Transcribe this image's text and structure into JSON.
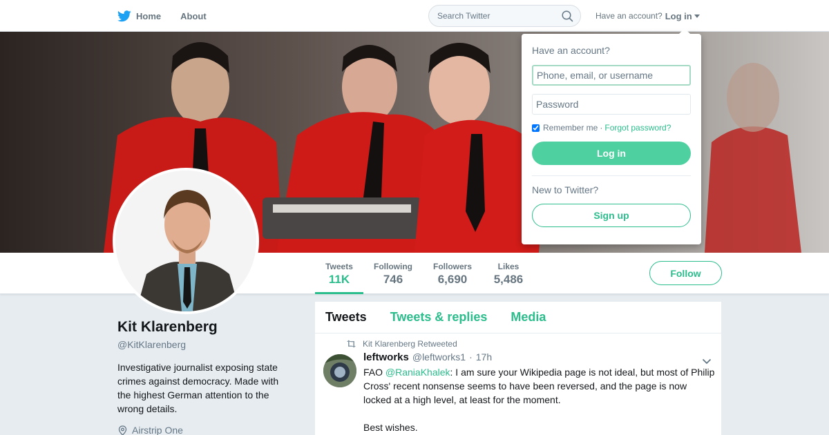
{
  "colors": {
    "accent": "#2bbd8b",
    "login_fill": "#4fd0a0",
    "muted": "#657786",
    "page_bg": "#e6ecf0"
  },
  "topbar": {
    "logo_icon": "twitter-bird-icon",
    "home_label": "Home",
    "about_label": "About",
    "search_placeholder": "Search Twitter",
    "have_account": "Have an account?",
    "login_label": "Log in"
  },
  "login_dropdown": {
    "title": "Have an account?",
    "username_placeholder": "Phone, email, or username",
    "password_placeholder": "Password",
    "remember_label": "Remember me",
    "separator": "·",
    "forgot_label": "Forgot password?",
    "login_button": "Log in",
    "new_prompt": "New to Twitter?",
    "signup_button": "Sign up"
  },
  "stats": {
    "tweets_label": "Tweets",
    "tweets_value": "11K",
    "following_label": "Following",
    "following_value": "746",
    "followers_label": "Followers",
    "followers_value": "6,690",
    "likes_label": "Likes",
    "likes_value": "5,486",
    "follow_button": "Follow"
  },
  "profile": {
    "name": "Kit Klarenberg",
    "handle": "@KitKlarenberg",
    "bio": "Investigative journalist exposing state crimes against democracy. Made with the highest German attention to the wrong details.",
    "location": "Airstrip One"
  },
  "timeline": {
    "tabs": [
      "Tweets",
      "Tweets & replies",
      "Media"
    ],
    "tweet": {
      "retweeted_by": "Kit Klarenberg Retweeted",
      "name": "leftworks",
      "handle": "@leftworks1",
      "separator": "·",
      "time": "17h",
      "text_prefix": "FAO ",
      "mention": "@RaniaKhalek",
      "text_body": ": I am sure your Wikipedia page is not ideal, but most of Philip Cross' recent nonsense seems to have been reversed, and the page is now locked at a high level, at least for the moment.",
      "text_second": "Best wishes."
    }
  }
}
